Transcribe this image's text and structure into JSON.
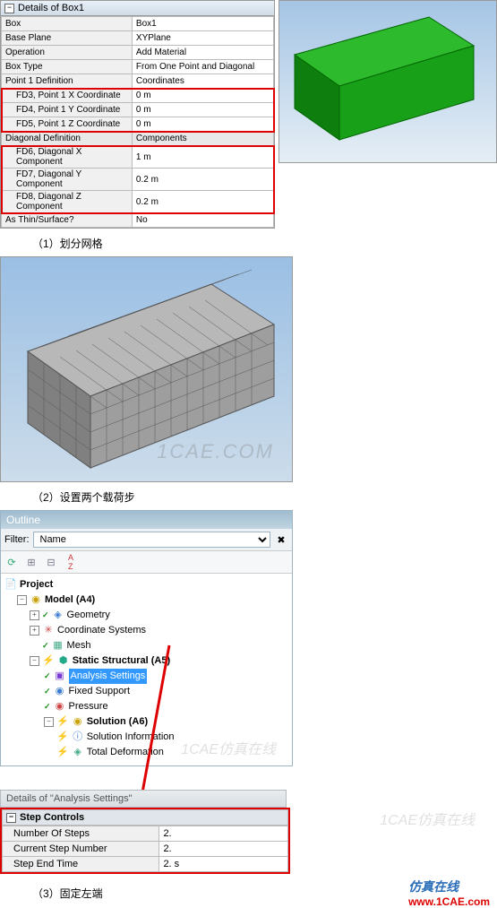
{
  "details1": {
    "title": "Details of Box1",
    "rows": [
      {
        "label": "Box",
        "value": "Box1"
      },
      {
        "label": "Base Plane",
        "value": "XYPlane"
      },
      {
        "label": "Operation",
        "value": "Add Material"
      },
      {
        "label": "Box Type",
        "value": "From One Point and Diagonal"
      },
      {
        "label": "Point 1 Definition",
        "value": "Coordinates"
      }
    ],
    "group_a": [
      {
        "label": "FD3, Point 1 X Coordinate",
        "value": "0 m"
      },
      {
        "label": "FD4, Point 1 Y Coordinate",
        "value": "0 m"
      },
      {
        "label": "FD5, Point 1 Z Coordinate",
        "value": "0 m"
      }
    ],
    "diag_label": "Diagonal Definition",
    "diag_value": "Components",
    "group_b": [
      {
        "label": "FD6, Diagonal X Component",
        "value": "1 m"
      },
      {
        "label": "FD7, Diagonal Y Component",
        "value": "0.2 m"
      },
      {
        "label": "FD8, Diagonal Z Component",
        "value": "0.2 m"
      }
    ],
    "thin_label": "As Thin/Surface?",
    "thin_value": "No"
  },
  "caption1": "（1）划分网格",
  "caption2": "（2）设置两个载荷步",
  "caption3": "（3）固定左端",
  "watermark": "1CAE.COM",
  "outline": {
    "title": "Outline",
    "filter_label": "Filter:",
    "filter_value": "Name",
    "tree": {
      "project": "Project",
      "model": "Model (A4)",
      "geometry": "Geometry",
      "coord": "Coordinate Systems",
      "mesh": "Mesh",
      "static": "Static Structural (A5)",
      "analysis": "Analysis Settings",
      "fixed": "Fixed Support",
      "pressure": "Pressure",
      "solution": "Solution (A6)",
      "solinfo": "Solution Information",
      "totaldef": "Total Deformation"
    }
  },
  "details2": {
    "title": "Details of \"Analysis Settings\"",
    "section": "Step Controls",
    "rows": [
      {
        "label": "Number Of Steps",
        "value": "2."
      },
      {
        "label": "Current Step Number",
        "value": "2."
      },
      {
        "label": "Step End Time",
        "value": "2. s"
      }
    ]
  },
  "brand_cn": "仿真在线",
  "brand_url": "www.1CAE.com"
}
